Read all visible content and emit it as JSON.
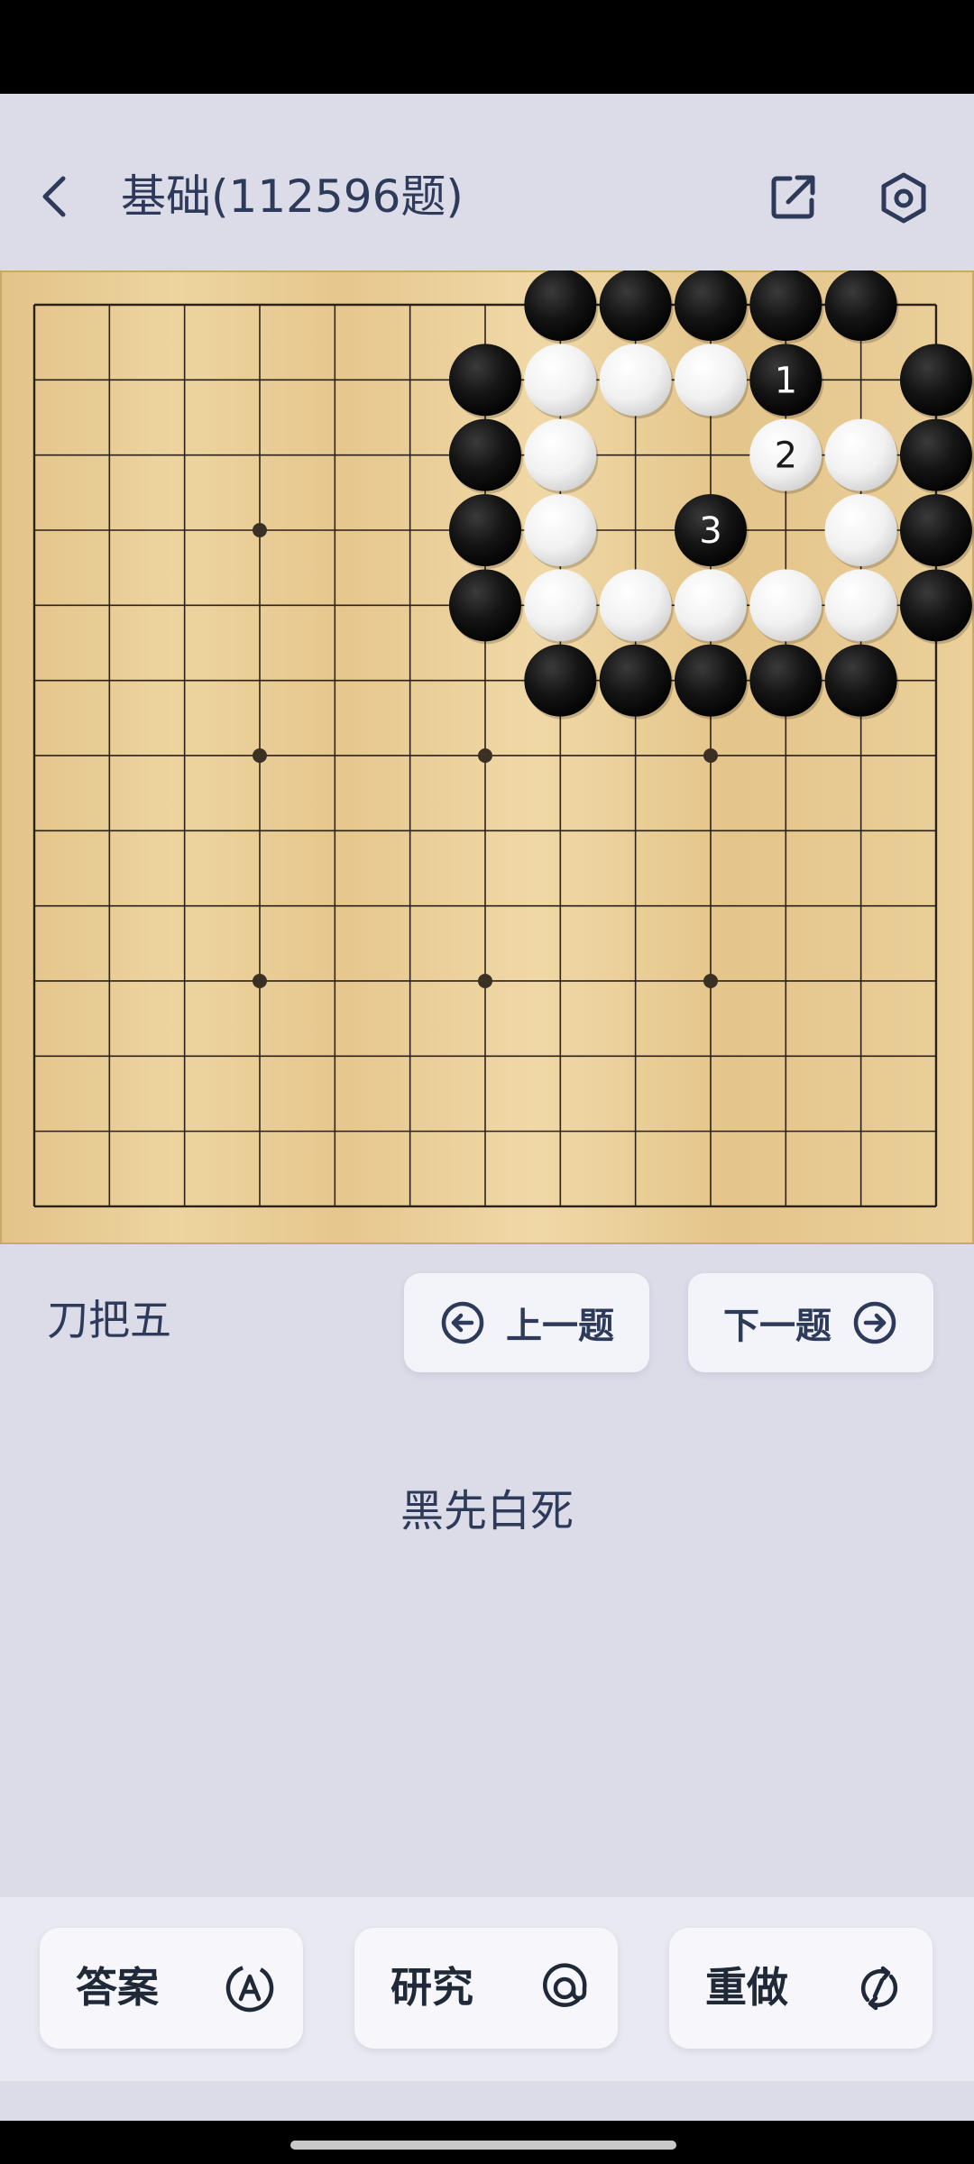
{
  "header": {
    "title": "基础(112596题)",
    "back_icon": "chevron-left-icon",
    "share_icon": "share-external-icon",
    "settings_icon": "hexagon-settings-icon"
  },
  "board": {
    "size": 13,
    "star_points": [
      [
        3,
        3
      ],
      [
        3,
        6
      ],
      [
        6,
        6
      ],
      [
        9,
        6
      ],
      [
        3,
        9
      ],
      [
        6,
        9
      ],
      [
        9,
        9
      ]
    ],
    "stones": [
      {
        "color": "black",
        "col": 7,
        "row": 0
      },
      {
        "color": "black",
        "col": 8,
        "row": 0
      },
      {
        "color": "black",
        "col": 9,
        "row": 0
      },
      {
        "color": "black",
        "col": 10,
        "row": 0
      },
      {
        "color": "black",
        "col": 11,
        "row": 0
      },
      {
        "color": "black",
        "col": 6,
        "row": 1
      },
      {
        "color": "white",
        "col": 7,
        "row": 1
      },
      {
        "color": "white",
        "col": 8,
        "row": 1
      },
      {
        "color": "white",
        "col": 9,
        "row": 1
      },
      {
        "color": "black",
        "col": 10,
        "row": 1,
        "label": "1"
      },
      {
        "color": "black",
        "col": 12,
        "row": 1
      },
      {
        "color": "black",
        "col": 6,
        "row": 2
      },
      {
        "color": "white",
        "col": 7,
        "row": 2
      },
      {
        "color": "white",
        "col": 10,
        "row": 2,
        "label": "2"
      },
      {
        "color": "white",
        "col": 11,
        "row": 2
      },
      {
        "color": "black",
        "col": 12,
        "row": 2
      },
      {
        "color": "black",
        "col": 6,
        "row": 3
      },
      {
        "color": "white",
        "col": 7,
        "row": 3
      },
      {
        "color": "black",
        "col": 9,
        "row": 3,
        "label": "3"
      },
      {
        "color": "white",
        "col": 11,
        "row": 3
      },
      {
        "color": "black",
        "col": 12,
        "row": 3
      },
      {
        "color": "black",
        "col": 6,
        "row": 4
      },
      {
        "color": "white",
        "col": 7,
        "row": 4
      },
      {
        "color": "white",
        "col": 8,
        "row": 4
      },
      {
        "color": "white",
        "col": 9,
        "row": 4
      },
      {
        "color": "white",
        "col": 10,
        "row": 4
      },
      {
        "color": "white",
        "col": 11,
        "row": 4
      },
      {
        "color": "black",
        "col": 12,
        "row": 4
      },
      {
        "color": "black",
        "col": 7,
        "row": 5
      },
      {
        "color": "black",
        "col": 8,
        "row": 5
      },
      {
        "color": "black",
        "col": 9,
        "row": 5
      },
      {
        "color": "black",
        "col": 10,
        "row": 5
      },
      {
        "color": "black",
        "col": 11,
        "row": 5
      }
    ]
  },
  "problem": {
    "name": "刀把五",
    "hint": "黑先白死"
  },
  "nav": {
    "prev_label": "上一题",
    "next_label": "下一题",
    "prev_icon": "arrow-left-circle-icon",
    "next_icon": "arrow-right-circle-icon"
  },
  "actions": {
    "answer_label": "答案",
    "study_label": "研究",
    "redo_label": "重做",
    "answer_icon": "letter-a-circle-icon",
    "study_icon": "at-sign-icon",
    "redo_icon": "refresh-circle-icon"
  },
  "colors": {
    "background": "#dcdce8",
    "text": "#2e3a59",
    "board_wood": "#e8c98f",
    "board_line": "#2a2118"
  }
}
